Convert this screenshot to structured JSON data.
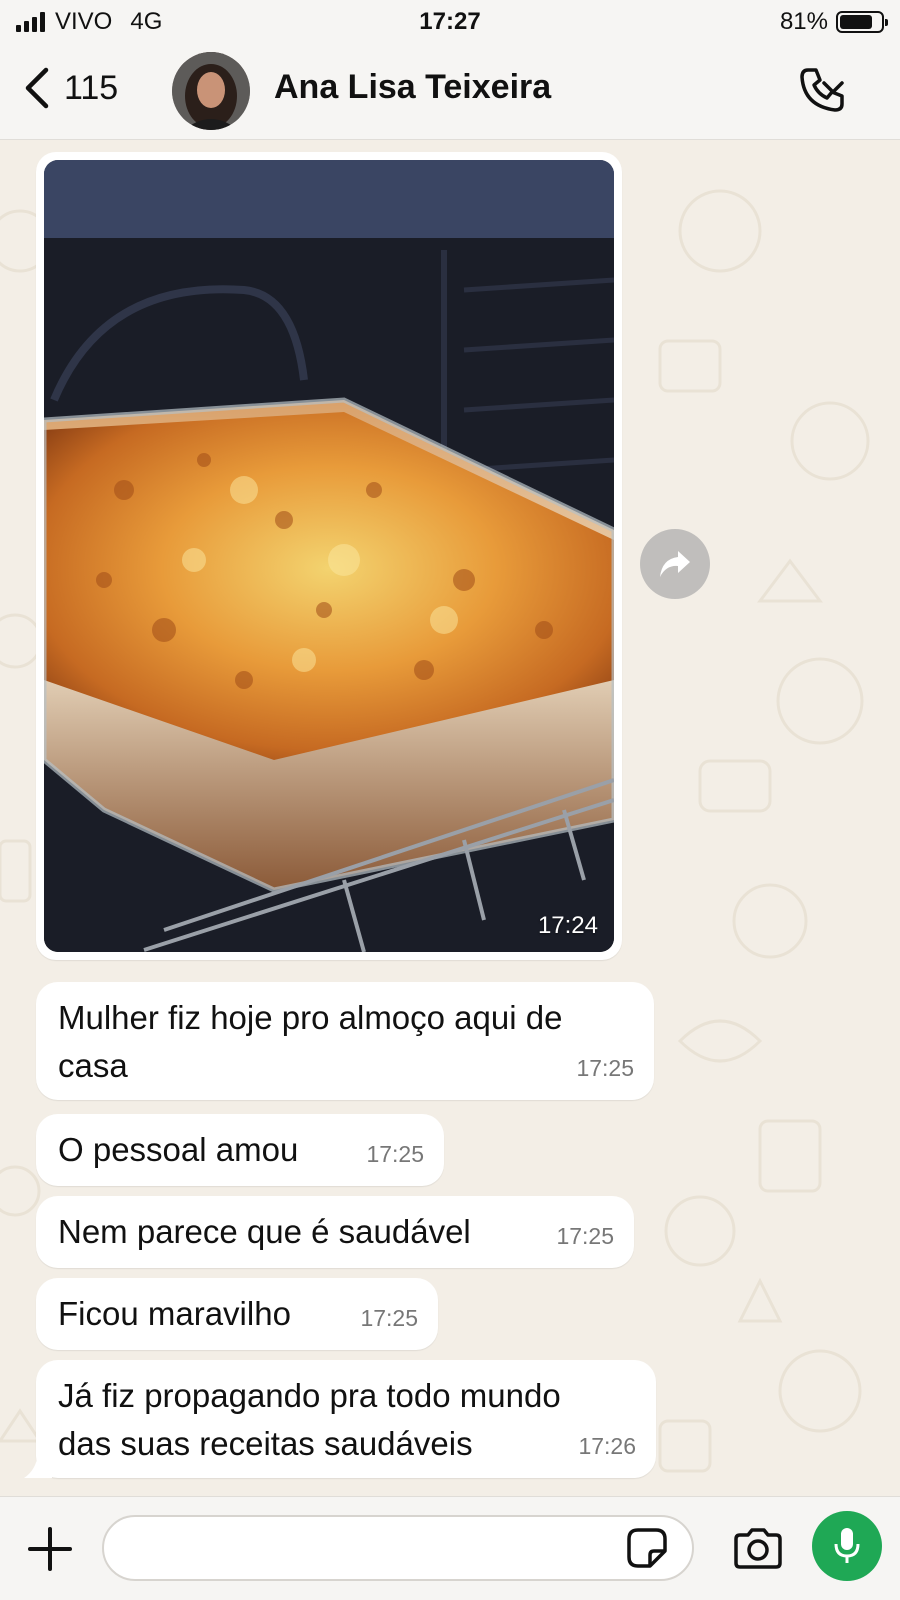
{
  "status_bar": {
    "carrier": "VIVO",
    "network": "4G",
    "time": "17:27",
    "battery": "81%",
    "battery_level": 0.81
  },
  "header": {
    "back_count": "115",
    "contact_name": "Ana Lisa Teixeira",
    "icons": [
      "chevron-left-icon",
      "phone-icon",
      "chevron-down-icon"
    ]
  },
  "chat": {
    "photo_message": {
      "time": "17:24"
    },
    "messages": [
      {
        "text": "Mulher fiz hoje pro almoço aqui de casa",
        "time": "17:25"
      },
      {
        "text": "O pessoal amou",
        "time": "17:25"
      },
      {
        "text": "Nem parece que é saudável",
        "time": "17:25"
      },
      {
        "text": "Ficou maravilho",
        "time": "17:25"
      },
      {
        "text": "Já fiz propagando pra todo mundo das suas receitas saudáveis",
        "time": "17:26"
      }
    ]
  },
  "composer": {
    "input_value": "",
    "icons": [
      "plus-icon",
      "sticker-icon",
      "camera-icon",
      "microphone-icon"
    ]
  },
  "colors": {
    "chat_background": "#f3eee6",
    "bubble": "#ffffff",
    "mic_button": "#1fa855",
    "time_text": "#777777"
  }
}
